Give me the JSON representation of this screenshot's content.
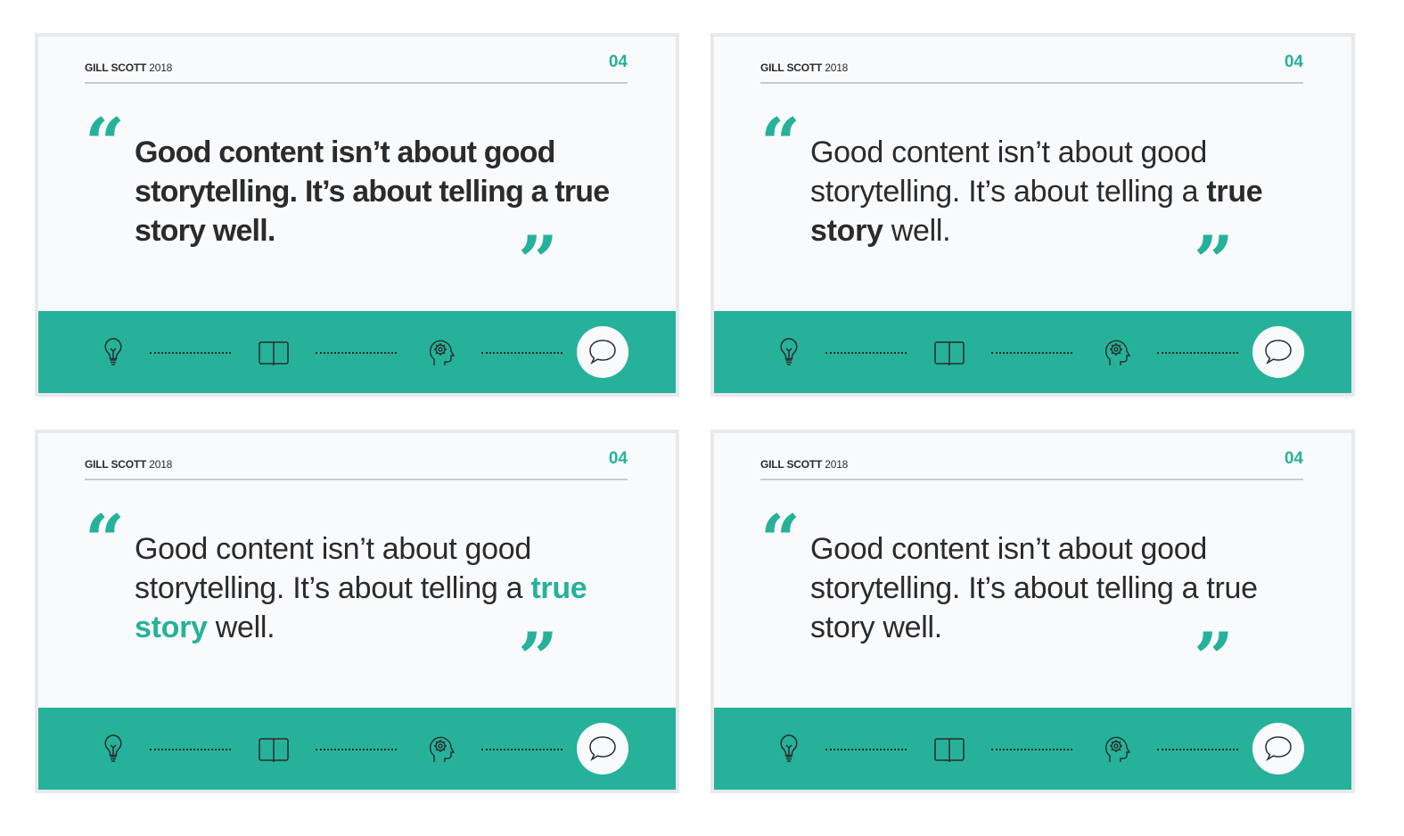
{
  "colors": {
    "accent": "#26b29a",
    "text": "#2b2b2b",
    "card_bg": "#f9fafc",
    "card_border": "#e8e9eb"
  },
  "cards": [
    {
      "brand_name": "GILL SCOTT",
      "brand_year": "2018",
      "page_number": "04",
      "quote_open": "“",
      "quote_close": "”",
      "quote_pre": "Good content isn’t about good storytelling. It’s about telling a ",
      "quote_highlight": "true story",
      "quote_post": " well.",
      "style": "all-bold",
      "icons": [
        "lightbulb-icon",
        "book-icon",
        "head-gear-icon",
        "chat-bubble-icon"
      ]
    },
    {
      "brand_name": "GILL SCOTT",
      "brand_year": "2018",
      "page_number": "04",
      "quote_open": "“",
      "quote_close": "”",
      "quote_pre": "Good content isn’t about good storytelling. It’s about telling a ",
      "quote_highlight": "true story",
      "quote_post": " well.",
      "style": "highlight-bold",
      "icons": [
        "lightbulb-icon",
        "book-icon",
        "head-gear-icon",
        "chat-bubble-icon"
      ]
    },
    {
      "brand_name": "GILL SCOTT",
      "brand_year": "2018",
      "page_number": "04",
      "quote_open": "“",
      "quote_close": "”",
      "quote_pre": "Good content isn’t about good storytelling. It’s about telling a ",
      "quote_highlight": "true story",
      "quote_post": " well.",
      "style": "highlight-green-bold",
      "icons": [
        "lightbulb-icon",
        "book-icon",
        "head-gear-icon",
        "chat-bubble-icon"
      ]
    },
    {
      "brand_name": "GILL SCOTT",
      "brand_year": "2018",
      "page_number": "04",
      "quote_open": "“",
      "quote_close": "”",
      "quote_pre": "Good content isn’t about good storytelling. It’s about telling a ",
      "quote_highlight": "true story",
      "quote_post": " well.",
      "style": "highlight-underline",
      "icons": [
        "lightbulb-icon",
        "book-icon",
        "head-gear-icon",
        "chat-bubble-icon"
      ]
    }
  ]
}
